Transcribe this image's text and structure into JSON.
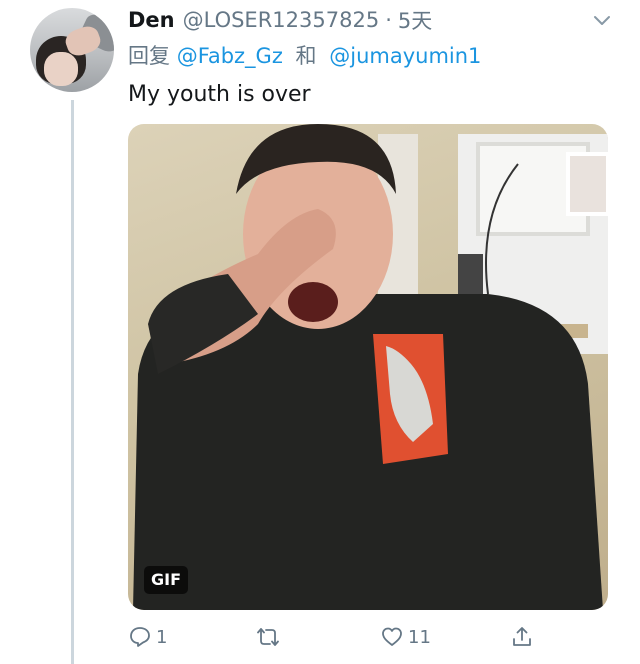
{
  "tweet": {
    "display_name": "Den",
    "handle": "@LOSER12357825",
    "separator": "·",
    "time": "5天",
    "reply_prefix": "回复",
    "reply_to": [
      "@Fabz_Gz",
      "@jumayumin1"
    ],
    "reply_joiner": "和",
    "text": "My youth is over",
    "media_badge": "GIF",
    "replies": "1",
    "likes": "11"
  },
  "colors": {
    "link": "#1b95e0",
    "secondary_text": "#657786",
    "thread_line": "#ccd6dd"
  },
  "icons": [
    "chevron-down-icon",
    "reply-icon",
    "retweet-icon",
    "like-icon",
    "share-icon"
  ]
}
